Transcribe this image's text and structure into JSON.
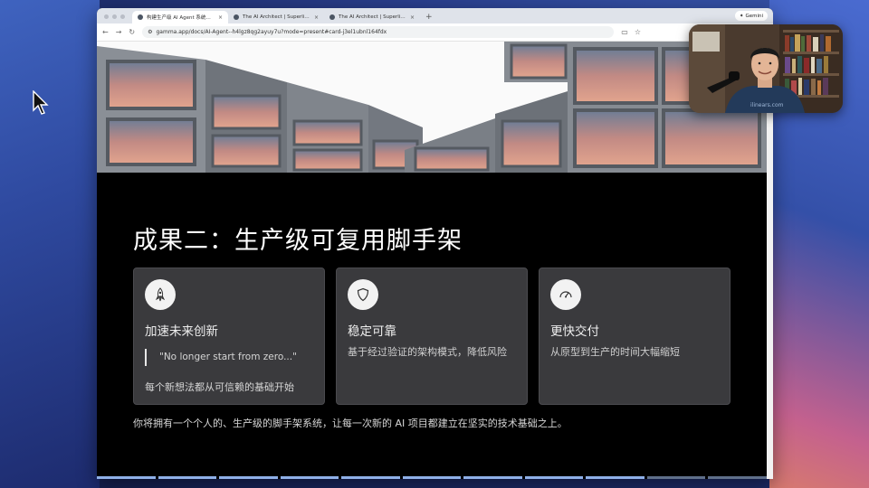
{
  "browser": {
    "tabs": [
      {
        "label": "构建生产级 AI Agent 系统的初",
        "active": true
      },
      {
        "label": "The AI Architect | Superlinear",
        "active": false
      },
      {
        "label": "The AI Architect | Superlinear",
        "active": false
      }
    ],
    "new_tab": "+",
    "gemini_label": "Gemini",
    "url": "gamma.app/docs/AI-Agent--h4lgz8qg2ayuy7u?mode=present#card-j3el1ubnl164fdx"
  },
  "slide": {
    "title": "成果二：生产级可复用脚手架",
    "cards": [
      {
        "title": "加速未来创新",
        "quote": "\"No longer start from zero...\"",
        "footer": "每个新想法都从可信赖的基础开始",
        "icon": "rocket-icon"
      },
      {
        "title": "稳定可靠",
        "description": "基于经过验证的架构模式，降低风险",
        "icon": "shield-icon"
      },
      {
        "title": "更快交付",
        "description": "从原型到生产的时间大幅缩短",
        "icon": "speedometer-icon"
      }
    ],
    "summary": "你将拥有一个个人的、生产级的脚手架系统，让每一次新的 AI 项目都建立在坚实的技术基础之上。"
  },
  "webcam": {
    "shirt_text": "ilinears.com"
  },
  "colors": {
    "slide_bg": "#000000",
    "card_bg": "#3a3a3d",
    "accent_progress": "#8fb0e8"
  }
}
